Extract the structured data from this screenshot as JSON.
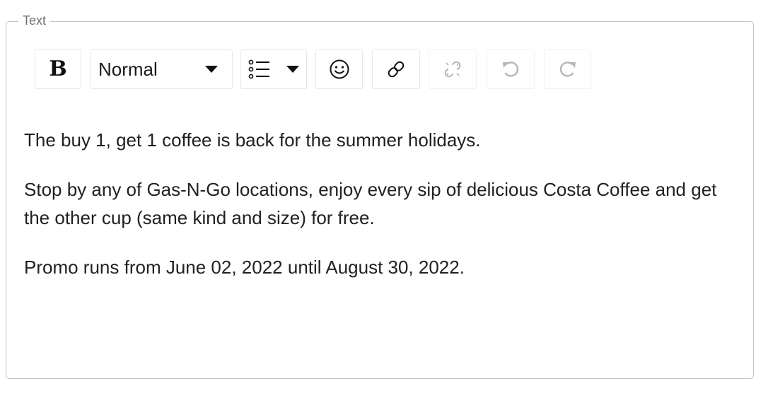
{
  "field": {
    "legend": "Text"
  },
  "toolbar": {
    "bold": {
      "glyph": "B",
      "icon": "bold-icon"
    },
    "block_type": {
      "selected": "Normal",
      "icon": "chevron-down-icon"
    },
    "list": {
      "icon": "unordered-list-icon"
    },
    "emoji": {
      "icon": "smiley-icon"
    },
    "link": {
      "icon": "link-icon"
    },
    "unlink": {
      "icon": "unlink-icon",
      "state": "disabled"
    },
    "undo": {
      "icon": "undo-icon",
      "state": "disabled"
    },
    "redo": {
      "icon": "redo-icon",
      "state": "disabled"
    }
  },
  "editor": {
    "paragraphs": [
      "The buy 1, get 1 coffee is back for the summer holidays.",
      "Stop by any of Gas-N-Go locations, enjoy every sip of delicious Costa Coffee and get the other cup (same kind and size) for free.",
      "Promo runs from June 02, 2022 until August 30, 2022."
    ]
  },
  "colors": {
    "border": "#c4c4c4",
    "legend_text": "#6f6f6f",
    "body_text": "#212121",
    "icon_active": "#111111",
    "icon_disabled": "#b5b5b5"
  }
}
